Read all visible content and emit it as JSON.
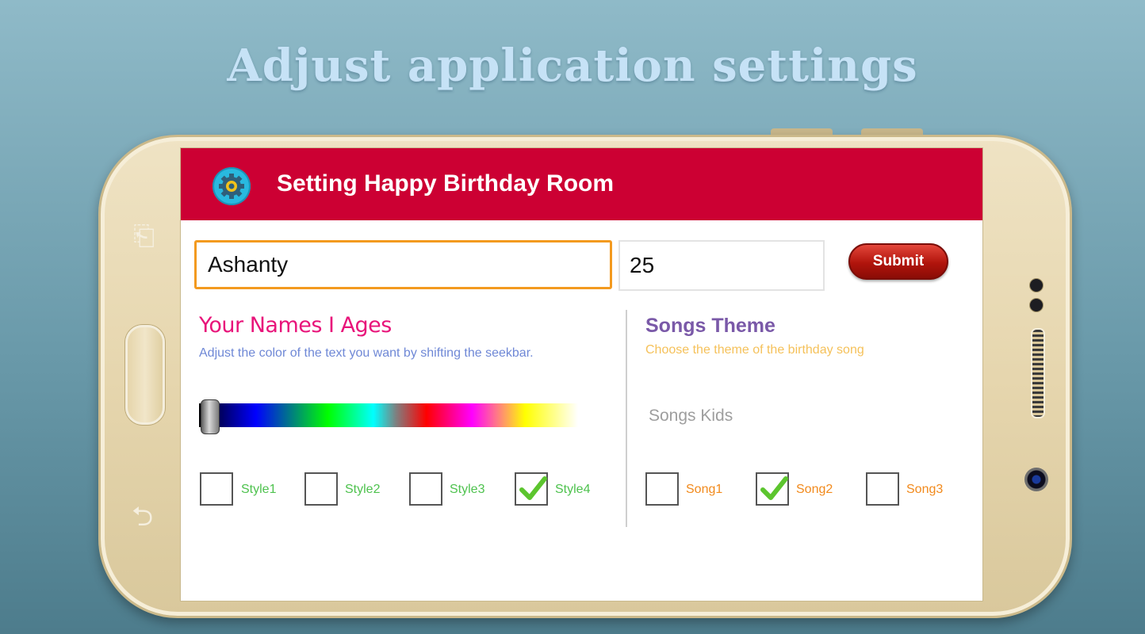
{
  "headline": "Adjust application settings",
  "toolbar": {
    "title": "Setting Happy Birthday Room",
    "icon": "gear-icon",
    "color": "#cc0033"
  },
  "form": {
    "name_value": "Ashanty",
    "age_value": "25",
    "submit_label": "Submit"
  },
  "names_section": {
    "title": "Your Names I Ages",
    "subtitle": "Adjust the color of the text you want by shifting the seekbar.",
    "seekbar_value": 0,
    "styles": [
      {
        "label": "Style1",
        "checked": false
      },
      {
        "label": "Style2",
        "checked": false
      },
      {
        "label": "Style3",
        "checked": false
      },
      {
        "label": "Style4",
        "checked": true
      }
    ]
  },
  "songs_section": {
    "title": "Songs Theme",
    "subtitle": "Choose the theme of the birthday song",
    "selected_theme": "Songs Kids",
    "songs": [
      {
        "label": "Song1",
        "checked": false
      },
      {
        "label": "Song2",
        "checked": true
      },
      {
        "label": "Song3",
        "checked": false
      }
    ]
  },
  "colors": {
    "accent_orange": "#f39a1f",
    "check_green": "#5cc52e",
    "title_pink": "#e8147a",
    "title_purple": "#7a59a8"
  }
}
